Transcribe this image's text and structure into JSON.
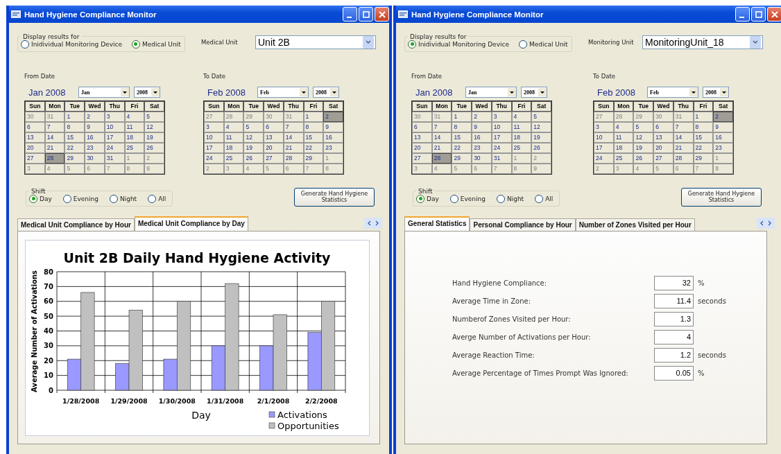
{
  "windows": [
    {
      "title": "Hand Hygiene Compliance Monitor",
      "display_group": {
        "label": "Display results for",
        "options": [
          {
            "label": "Inidividual Monitoring Device",
            "selected": false
          },
          {
            "label": "Medical Unit",
            "selected": true
          }
        ]
      },
      "unit": {
        "label": "Medical Unit",
        "value": "Unit 2B"
      },
      "from": {
        "label": "From Date",
        "calendar": {
          "title": "Jan 2008",
          "month": "Jan",
          "year": "2008",
          "weekdays": [
            "Sun",
            "Mon",
            "Tue",
            "Wed",
            "Thu",
            "Fri",
            "Sat"
          ],
          "weeks": [
            [
              {
                "d": "30",
                "in": false,
                "sel": false
              },
              {
                "d": "31",
                "in": false,
                "sel": false
              },
              {
                "d": "1",
                "in": true,
                "sel": false
              },
              {
                "d": "2",
                "in": true,
                "sel": false
              },
              {
                "d": "3",
                "in": true,
                "sel": false
              },
              {
                "d": "4",
                "in": true,
                "sel": false
              },
              {
                "d": "5",
                "in": true,
                "sel": false
              }
            ],
            [
              {
                "d": "6",
                "in": true,
                "sel": false
              },
              {
                "d": "7",
                "in": true,
                "sel": false
              },
              {
                "d": "8",
                "in": true,
                "sel": false
              },
              {
                "d": "9",
                "in": true,
                "sel": false
              },
              {
                "d": "10",
                "in": true,
                "sel": false
              },
              {
                "d": "11",
                "in": true,
                "sel": false
              },
              {
                "d": "12",
                "in": true,
                "sel": false
              }
            ],
            [
              {
                "d": "13",
                "in": true,
                "sel": false
              },
              {
                "d": "14",
                "in": true,
                "sel": false
              },
              {
                "d": "15",
                "in": true,
                "sel": false
              },
              {
                "d": "16",
                "in": true,
                "sel": false
              },
              {
                "d": "17",
                "in": true,
                "sel": false
              },
              {
                "d": "18",
                "in": true,
                "sel": false
              },
              {
                "d": "19",
                "in": true,
                "sel": false
              }
            ],
            [
              {
                "d": "20",
                "in": true,
                "sel": false
              },
              {
                "d": "21",
                "in": true,
                "sel": false
              },
              {
                "d": "22",
                "in": true,
                "sel": false
              },
              {
                "d": "23",
                "in": true,
                "sel": false
              },
              {
                "d": "24",
                "in": true,
                "sel": false
              },
              {
                "d": "25",
                "in": true,
                "sel": false
              },
              {
                "d": "26",
                "in": true,
                "sel": false
              }
            ],
            [
              {
                "d": "27",
                "in": true,
                "sel": false
              },
              {
                "d": "28",
                "in": true,
                "sel": true
              },
              {
                "d": "29",
                "in": true,
                "sel": false
              },
              {
                "d": "30",
                "in": true,
                "sel": false
              },
              {
                "d": "31",
                "in": true,
                "sel": false
              },
              {
                "d": "1",
                "in": false,
                "sel": false
              },
              {
                "d": "2",
                "in": false,
                "sel": false
              }
            ],
            [
              {
                "d": "3",
                "in": false,
                "sel": false
              },
              {
                "d": "4",
                "in": false,
                "sel": false
              },
              {
                "d": "5",
                "in": false,
                "sel": false
              },
              {
                "d": "6",
                "in": false,
                "sel": false
              },
              {
                "d": "7",
                "in": false,
                "sel": false
              },
              {
                "d": "8",
                "in": false,
                "sel": false
              },
              {
                "d": "9",
                "in": false,
                "sel": false
              }
            ]
          ]
        }
      },
      "to": {
        "label": "To Date",
        "calendar": {
          "title": "Feb 2008",
          "month": "Feb",
          "year": "2008",
          "weekdays": [
            "Sun",
            "Mon",
            "Tue",
            "Wed",
            "Thu",
            "Fri",
            "Sat"
          ],
          "weeks": [
            [
              {
                "d": "27",
                "in": false,
                "sel": false
              },
              {
                "d": "28",
                "in": false,
                "sel": false
              },
              {
                "d": "29",
                "in": false,
                "sel": false
              },
              {
                "d": "30",
                "in": false,
                "sel": false
              },
              {
                "d": "31",
                "in": false,
                "sel": false
              },
              {
                "d": "1",
                "in": true,
                "sel": false
              },
              {
                "d": "2",
                "in": true,
                "sel": true
              }
            ],
            [
              {
                "d": "3",
                "in": true,
                "sel": false
              },
              {
                "d": "4",
                "in": true,
                "sel": false
              },
              {
                "d": "5",
                "in": true,
                "sel": false
              },
              {
                "d": "6",
                "in": true,
                "sel": false
              },
              {
                "d": "7",
                "in": true,
                "sel": false
              },
              {
                "d": "8",
                "in": true,
                "sel": false
              },
              {
                "d": "9",
                "in": true,
                "sel": false
              }
            ],
            [
              {
                "d": "10",
                "in": true,
                "sel": false
              },
              {
                "d": "11",
                "in": true,
                "sel": false
              },
              {
                "d": "12",
                "in": true,
                "sel": false
              },
              {
                "d": "13",
                "in": true,
                "sel": false
              },
              {
                "d": "14",
                "in": true,
                "sel": false
              },
              {
                "d": "15",
                "in": true,
                "sel": false
              },
              {
                "d": "16",
                "in": true,
                "sel": false
              }
            ],
            [
              {
                "d": "17",
                "in": true,
                "sel": false
              },
              {
                "d": "18",
                "in": true,
                "sel": false
              },
              {
                "d": "19",
                "in": true,
                "sel": false
              },
              {
                "d": "20",
                "in": true,
                "sel": false
              },
              {
                "d": "21",
                "in": true,
                "sel": false
              },
              {
                "d": "22",
                "in": true,
                "sel": false
              },
              {
                "d": "23",
                "in": true,
                "sel": false
              }
            ],
            [
              {
                "d": "24",
                "in": true,
                "sel": false
              },
              {
                "d": "25",
                "in": true,
                "sel": false
              },
              {
                "d": "26",
                "in": true,
                "sel": false
              },
              {
                "d": "27",
                "in": true,
                "sel": false
              },
              {
                "d": "28",
                "in": true,
                "sel": false
              },
              {
                "d": "29",
                "in": true,
                "sel": false
              },
              {
                "d": "1",
                "in": false,
                "sel": false
              }
            ],
            [
              {
                "d": "2",
                "in": false,
                "sel": false
              },
              {
                "d": "3",
                "in": false,
                "sel": false
              },
              {
                "d": "4",
                "in": false,
                "sel": false
              },
              {
                "d": "5",
                "in": false,
                "sel": false
              },
              {
                "d": "6",
                "in": false,
                "sel": false
              },
              {
                "d": "7",
                "in": false,
                "sel": false
              },
              {
                "d": "8",
                "in": false,
                "sel": false
              }
            ]
          ]
        }
      },
      "shift": {
        "label": "Shift",
        "options": [
          {
            "label": "Day",
            "selected": true
          },
          {
            "label": "Evening",
            "selected": false
          },
          {
            "label": "Night",
            "selected": false
          },
          {
            "label": "All",
            "selected": false
          }
        ]
      },
      "generate_button": "Generate Hand Hygiene Statistics",
      "tabs": [
        {
          "label": "Medical Unit Compliance by Hour",
          "selected": false
        },
        {
          "label": "Medical Unit Compliance by Day",
          "selected": true
        }
      ],
      "panel": {
        "kind": "chart",
        "chart_data": {
          "type": "bar",
          "title": "Unit 2B Daily Hand Hygiene Activity",
          "xlabel": "Day",
          "ylabel": "Average Number of Activations",
          "categories": [
            "1/28/2008",
            "1/29/2008",
            "1/30/2008",
            "1/31/2008",
            "2/1/2008",
            "2/2/2008"
          ],
          "series": [
            {
              "name": "Activations",
              "color": "#9999ff",
              "values": [
                21,
                18,
                21,
                30,
                30,
                39
              ]
            },
            {
              "name": "Opportunities",
              "color": "#c0c0c0",
              "values": [
                66,
                54,
                60,
                72,
                51,
                60
              ]
            }
          ],
          "ylim": [
            0,
            80
          ],
          "yticks": [
            0,
            10,
            20,
            30,
            40,
            50,
            60,
            70,
            80
          ],
          "grid": true,
          "legend": "bottom-right"
        }
      }
    },
    {
      "title": "Hand Hygiene Compliance Monitor",
      "display_group": {
        "label": "Display results for",
        "options": [
          {
            "label": "Inidividual Monitoring Device",
            "selected": true
          },
          {
            "label": "Medical Unit",
            "selected": false
          }
        ]
      },
      "unit": {
        "label": "Monitoring Unit",
        "value": "MonitoringUnit_18"
      },
      "from": {
        "label": "From Date",
        "calendar": {
          "title": "Jan 2008",
          "month": "Jan",
          "year": "2008",
          "weekdays": [
            "Sun",
            "Mon",
            "Tue",
            "Wed",
            "Thu",
            "Fri",
            "Sat"
          ],
          "weeks": [
            [
              {
                "d": "30",
                "in": false,
                "sel": false
              },
              {
                "d": "31",
                "in": false,
                "sel": false
              },
              {
                "d": "1",
                "in": true,
                "sel": false
              },
              {
                "d": "2",
                "in": true,
                "sel": false
              },
              {
                "d": "3",
                "in": true,
                "sel": false
              },
              {
                "d": "4",
                "in": true,
                "sel": false
              },
              {
                "d": "5",
                "in": true,
                "sel": false
              }
            ],
            [
              {
                "d": "6",
                "in": true,
                "sel": false
              },
              {
                "d": "7",
                "in": true,
                "sel": false
              },
              {
                "d": "8",
                "in": true,
                "sel": false
              },
              {
                "d": "9",
                "in": true,
                "sel": false
              },
              {
                "d": "10",
                "in": true,
                "sel": false
              },
              {
                "d": "11",
                "in": true,
                "sel": false
              },
              {
                "d": "12",
                "in": true,
                "sel": false
              }
            ],
            [
              {
                "d": "13",
                "in": true,
                "sel": false
              },
              {
                "d": "14",
                "in": true,
                "sel": false
              },
              {
                "d": "15",
                "in": true,
                "sel": false
              },
              {
                "d": "16",
                "in": true,
                "sel": false
              },
              {
                "d": "17",
                "in": true,
                "sel": false
              },
              {
                "d": "18",
                "in": true,
                "sel": false
              },
              {
                "d": "19",
                "in": true,
                "sel": false
              }
            ],
            [
              {
                "d": "20",
                "in": true,
                "sel": false
              },
              {
                "d": "21",
                "in": true,
                "sel": false
              },
              {
                "d": "22",
                "in": true,
                "sel": false
              },
              {
                "d": "23",
                "in": true,
                "sel": false
              },
              {
                "d": "24",
                "in": true,
                "sel": false
              },
              {
                "d": "25",
                "in": true,
                "sel": false
              },
              {
                "d": "26",
                "in": true,
                "sel": false
              }
            ],
            [
              {
                "d": "27",
                "in": true,
                "sel": false
              },
              {
                "d": "28",
                "in": true,
                "sel": true
              },
              {
                "d": "29",
                "in": true,
                "sel": false
              },
              {
                "d": "30",
                "in": true,
                "sel": false
              },
              {
                "d": "31",
                "in": true,
                "sel": false
              },
              {
                "d": "1",
                "in": false,
                "sel": false
              },
              {
                "d": "2",
                "in": false,
                "sel": false
              }
            ],
            [
              {
                "d": "3",
                "in": false,
                "sel": false
              },
              {
                "d": "4",
                "in": false,
                "sel": false
              },
              {
                "d": "5",
                "in": false,
                "sel": false
              },
              {
                "d": "6",
                "in": false,
                "sel": false
              },
              {
                "d": "7",
                "in": false,
                "sel": false
              },
              {
                "d": "8",
                "in": false,
                "sel": false
              },
              {
                "d": "9",
                "in": false,
                "sel": false
              }
            ]
          ]
        }
      },
      "to": {
        "label": "To Date",
        "calendar": {
          "title": "Feb 2008",
          "month": "Feb",
          "year": "2008",
          "weekdays": [
            "Sun",
            "Mon",
            "Tue",
            "Wed",
            "Thu",
            "Fri",
            "Sat"
          ],
          "weeks": [
            [
              {
                "d": "27",
                "in": false,
                "sel": false
              },
              {
                "d": "28",
                "in": false,
                "sel": false
              },
              {
                "d": "29",
                "in": false,
                "sel": false
              },
              {
                "d": "30",
                "in": false,
                "sel": false
              },
              {
                "d": "31",
                "in": false,
                "sel": false
              },
              {
                "d": "1",
                "in": true,
                "sel": false
              },
              {
                "d": "2",
                "in": true,
                "sel": true
              }
            ],
            [
              {
                "d": "3",
                "in": true,
                "sel": false
              },
              {
                "d": "4",
                "in": true,
                "sel": false
              },
              {
                "d": "5",
                "in": true,
                "sel": false
              },
              {
                "d": "6",
                "in": true,
                "sel": false
              },
              {
                "d": "7",
                "in": true,
                "sel": false
              },
              {
                "d": "8",
                "in": true,
                "sel": false
              },
              {
                "d": "9",
                "in": true,
                "sel": false
              }
            ],
            [
              {
                "d": "10",
                "in": true,
                "sel": false
              },
              {
                "d": "11",
                "in": true,
                "sel": false
              },
              {
                "d": "12",
                "in": true,
                "sel": false
              },
              {
                "d": "13",
                "in": true,
                "sel": false
              },
              {
                "d": "14",
                "in": true,
                "sel": false
              },
              {
                "d": "15",
                "in": true,
                "sel": false
              },
              {
                "d": "16",
                "in": true,
                "sel": false
              }
            ],
            [
              {
                "d": "17",
                "in": true,
                "sel": false
              },
              {
                "d": "18",
                "in": true,
                "sel": false
              },
              {
                "d": "19",
                "in": true,
                "sel": false
              },
              {
                "d": "20",
                "in": true,
                "sel": false
              },
              {
                "d": "21",
                "in": true,
                "sel": false
              },
              {
                "d": "22",
                "in": true,
                "sel": false
              },
              {
                "d": "23",
                "in": true,
                "sel": false
              }
            ],
            [
              {
                "d": "24",
                "in": true,
                "sel": false
              },
              {
                "d": "25",
                "in": true,
                "sel": false
              },
              {
                "d": "26",
                "in": true,
                "sel": false
              },
              {
                "d": "27",
                "in": true,
                "sel": false
              },
              {
                "d": "28",
                "in": true,
                "sel": false
              },
              {
                "d": "29",
                "in": true,
                "sel": false
              },
              {
                "d": "1",
                "in": false,
                "sel": false
              }
            ],
            [
              {
                "d": "2",
                "in": false,
                "sel": false
              },
              {
                "d": "3",
                "in": false,
                "sel": false
              },
              {
                "d": "4",
                "in": false,
                "sel": false
              },
              {
                "d": "5",
                "in": false,
                "sel": false
              },
              {
                "d": "6",
                "in": false,
                "sel": false
              },
              {
                "d": "7",
                "in": false,
                "sel": false
              },
              {
                "d": "8",
                "in": false,
                "sel": false
              }
            ]
          ]
        }
      },
      "shift": {
        "label": "Shift",
        "options": [
          {
            "label": "Day",
            "selected": true
          },
          {
            "label": "Evening",
            "selected": false
          },
          {
            "label": "Night",
            "selected": false
          },
          {
            "label": "All",
            "selected": false
          }
        ]
      },
      "generate_button": "Generate Hand Hygiene Statistics",
      "tabs": [
        {
          "label": "General Statistics",
          "selected": true
        },
        {
          "label": "Personal Compliance by Hour",
          "selected": false
        },
        {
          "label": "Number of Zones Visited per Hour",
          "selected": false
        }
      ],
      "panel": {
        "kind": "stats",
        "rows": [
          {
            "label": "Hand Hygiene Compliance:",
            "value": "32",
            "unit": "%"
          },
          {
            "label": "Average Time in Zone:",
            "value": "11.4",
            "unit": "seconds"
          },
          {
            "label": "Numberof Zones Visited per Hour:",
            "value": "1.3"
          },
          {
            "label": "Averge Number of Activations per Hour:",
            "value": "4"
          },
          {
            "label": "Average Reaction Time:",
            "value": "1.2",
            "unit": "seconds"
          },
          {
            "label": "Average Percentage of Times Prompt Was Ignored:",
            "value": "0.05",
            "unit": "%"
          }
        ]
      }
    }
  ]
}
